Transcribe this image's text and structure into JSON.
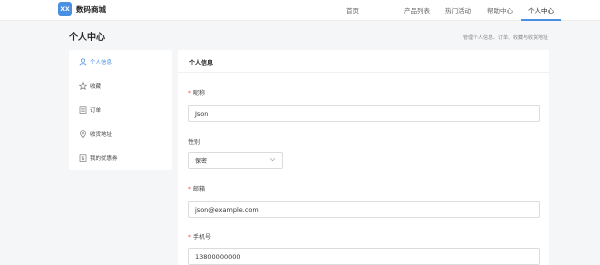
{
  "header": {
    "logo_text": "XX",
    "brand": "数码商城",
    "nav": [
      "首页",
      "产品列表",
      "热门活动",
      "帮助中心",
      "个人中心"
    ],
    "active_nav": "个人中心",
    "accent": "#4a90e2"
  },
  "page": {
    "title": "个人中心",
    "subtitle": "管理个人信息、订单、收藏与收货地址"
  },
  "sidebar": {
    "items": [
      {
        "label": "个人信息",
        "icon": "user-icon",
        "active": true
      },
      {
        "label": "收藏",
        "icon": "star-icon",
        "active": false
      },
      {
        "label": "订单",
        "icon": "list-icon",
        "active": false
      },
      {
        "label": "收货地址",
        "icon": "location-icon",
        "active": false
      },
      {
        "label": "我的优惠券",
        "icon": "coupon-icon",
        "active": false
      }
    ]
  },
  "profile": {
    "title": "个人信息",
    "nickname_label": "昵称",
    "nickname_value": "Json",
    "gender_label": "性别",
    "gender_value": "保密",
    "email_label": "邮箱",
    "email_value": "json@example.com",
    "phone_label": "手机号",
    "phone_value": "13800000000",
    "required_mark": "*"
  }
}
